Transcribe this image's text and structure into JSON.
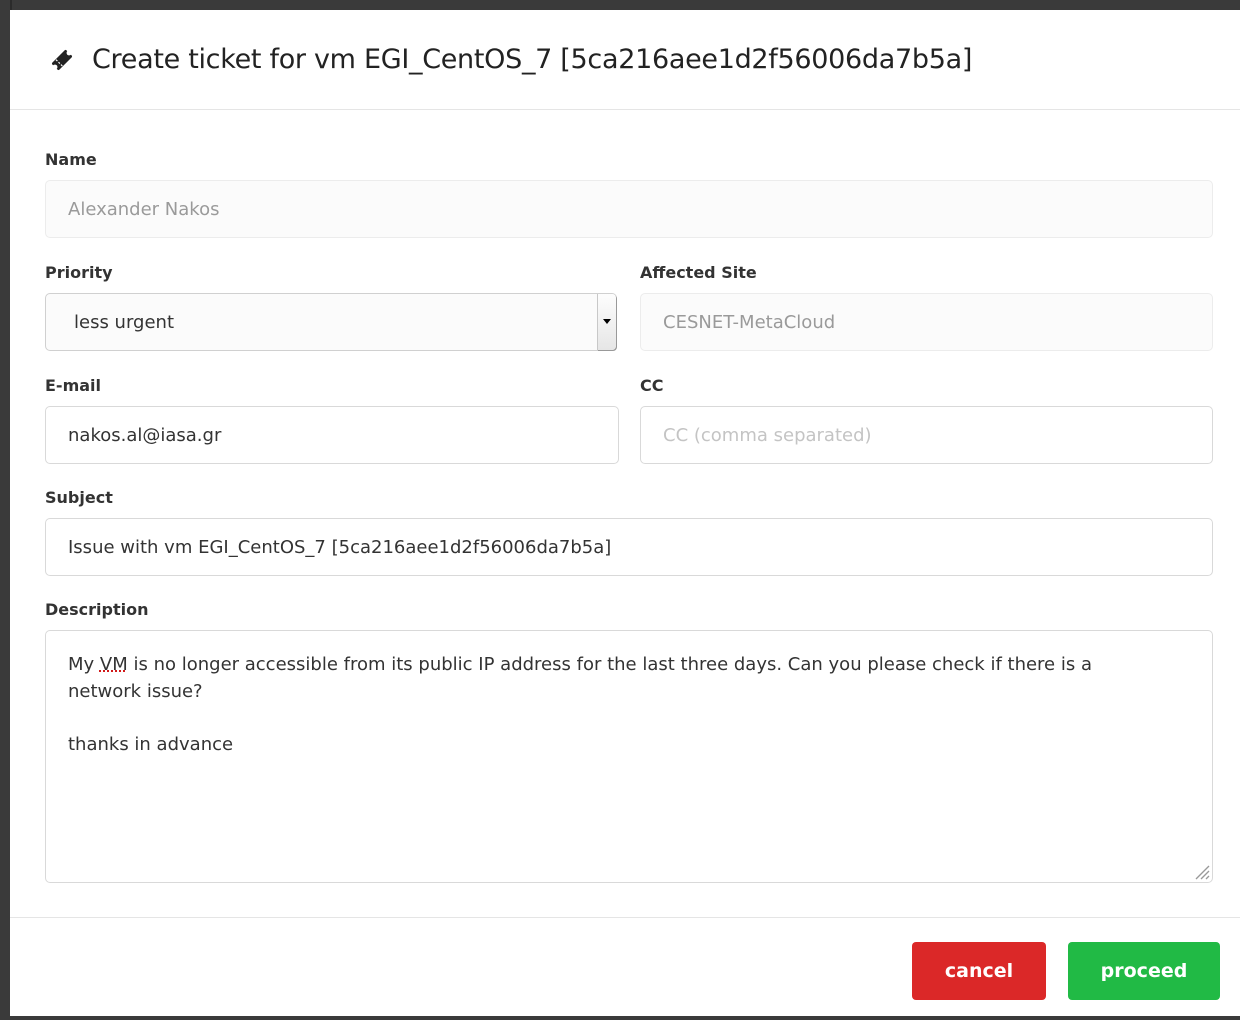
{
  "modal": {
    "title": "Create ticket for vm EGI_CentOS_7 [5ca216aee1d2f56006da7b5a]",
    "icon": "ticket-icon"
  },
  "form": {
    "name": {
      "label": "Name",
      "value": "Alexander Nakos"
    },
    "priority": {
      "label": "Priority",
      "selected": "less urgent"
    },
    "affected_site": {
      "label": "Affected Site",
      "value": "CESNET-MetaCloud"
    },
    "email": {
      "label": "E-mail",
      "value": "nakos.al@iasa.gr"
    },
    "cc": {
      "label": "CC",
      "placeholder": "CC (comma separated)"
    },
    "subject": {
      "label": "Subject",
      "value": "Issue with vm EGI_CentOS_7 [5ca216aee1d2f56006da7b5a]"
    },
    "description": {
      "label": "Description",
      "line1_pre": "My ",
      "line1_spell": "VM",
      "line1_post": " is no longer accessible from its public IP address for the last three days. Can you please check if there is a",
      "line2": "network issue?",
      "line3": "thanks in advance"
    }
  },
  "footer": {
    "cancel_label": "cancel",
    "proceed_label": "proceed"
  }
}
